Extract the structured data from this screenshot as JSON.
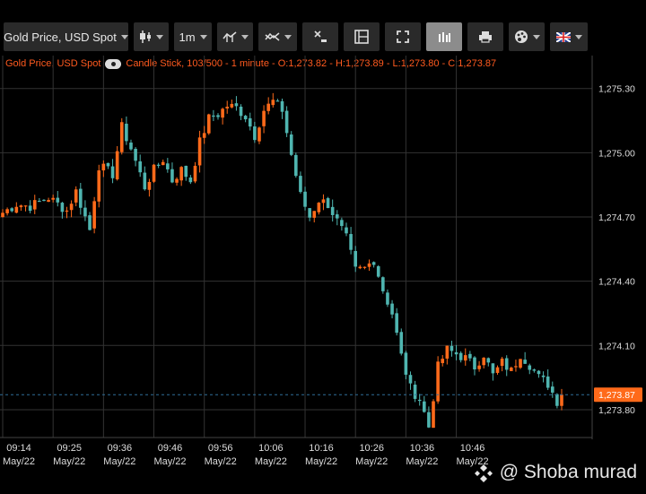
{
  "toolbar": {
    "symbol": "Gold Price, USD Spot",
    "interval": "1m",
    "icons": [
      "candlestick-icon",
      "indicator-icon",
      "compare-icon",
      "clear-drawings-icon",
      "layout-icon",
      "fullscreen-icon",
      "volume-bars-icon",
      "print-icon",
      "palette-icon",
      "uk-flag-icon"
    ]
  },
  "info_line": {
    "symbol": "Gold Price, USD Spot",
    "details": "Candle Stick, 103/500 - 1 minute - O:1,273.82 - H:1,273.89 - L:1,273.80 - C:1,273.87"
  },
  "chart_data": {
    "type": "candlestick",
    "interval": "1 minute",
    "ylim": [
      1273.67,
      1275.37
    ],
    "y_ticks": [
      "1,275.30",
      "1,275.00",
      "1,274.70",
      "1,274.40",
      "1,274.10",
      "1,273.80"
    ],
    "y_tick_values": [
      1275.3,
      1275.0,
      1274.7,
      1274.4,
      1274.1,
      1273.8
    ],
    "x_ticks": [
      {
        "time": "09:14",
        "date": "May/22"
      },
      {
        "time": "09:25",
        "date": "May/22"
      },
      {
        "time": "09:36",
        "date": "May/22"
      },
      {
        "time": "09:46",
        "date": "May/22"
      },
      {
        "time": "09:56",
        "date": "May/22"
      },
      {
        "time": "10:06",
        "date": "May/22"
      },
      {
        "time": "10:16",
        "date": "May/22"
      },
      {
        "time": "10:26",
        "date": "May/22"
      },
      {
        "time": "10:36",
        "date": "May/22"
      },
      {
        "time": "10:46",
        "date": "May/22"
      }
    ],
    "last_price": "1,273.87",
    "last_price_value": 1273.87,
    "colors": {
      "up": "#ff6a1a",
      "down": "#4fb5b0",
      "grid": "#333333",
      "last_line": "#2f6e99",
      "last_label": "#ff6a1a"
    },
    "close_path": [
      [
        0,
        1274.72
      ],
      [
        3,
        1274.76
      ],
      [
        6,
        1274.75
      ],
      [
        10,
        1274.79
      ],
      [
        14,
        1274.73
      ],
      [
        16,
        1274.82
      ],
      [
        19,
        1274.64
      ],
      [
        21,
        1274.94
      ],
      [
        24,
        1274.9
      ],
      [
        26,
        1275.12
      ],
      [
        28,
        1275.02
      ],
      [
        31,
        1274.84
      ],
      [
        33,
        1274.92
      ],
      [
        35,
        1274.97
      ],
      [
        37,
        1274.87
      ],
      [
        39,
        1274.92
      ],
      [
        41,
        1274.87
      ],
      [
        43,
        1275.05
      ],
      [
        45,
        1275.16
      ],
      [
        47,
        1275.18
      ],
      [
        49,
        1275.22
      ],
      [
        51,
        1275.21
      ],
      [
        53,
        1275.17
      ],
      [
        55,
        1275.08
      ],
      [
        57,
        1275.2
      ],
      [
        59,
        1275.24
      ],
      [
        61,
        1275.2
      ],
      [
        63,
        1274.99
      ],
      [
        65,
        1274.8
      ],
      [
        67,
        1274.7
      ],
      [
        69,
        1274.78
      ],
      [
        71,
        1274.76
      ],
      [
        73,
        1274.68
      ],
      [
        75,
        1274.6
      ],
      [
        77,
        1274.45
      ],
      [
        79,
        1274.46
      ],
      [
        81,
        1274.5
      ],
      [
        83,
        1274.36
      ],
      [
        85,
        1274.25
      ],
      [
        87,
        1274.05
      ],
      [
        89,
        1273.9
      ],
      [
        91,
        1273.85
      ],
      [
        93,
        1273.72
      ],
      [
        95,
        1274.0
      ],
      [
        97,
        1274.08
      ],
      [
        99,
        1274.06
      ],
      [
        101,
        1274.04
      ],
      [
        103,
        1274.0
      ],
      [
        105,
        1274.06
      ],
      [
        107,
        1273.96
      ],
      [
        109,
        1274.02
      ],
      [
        111,
        1273.98
      ],
      [
        113,
        1274.06
      ],
      [
        115,
        1274.01
      ],
      [
        117,
        1273.95
      ],
      [
        119,
        1273.92
      ],
      [
        121,
        1273.84
      ],
      [
        122,
        1273.87
      ]
    ]
  },
  "watermark": "@ Shoba murad"
}
